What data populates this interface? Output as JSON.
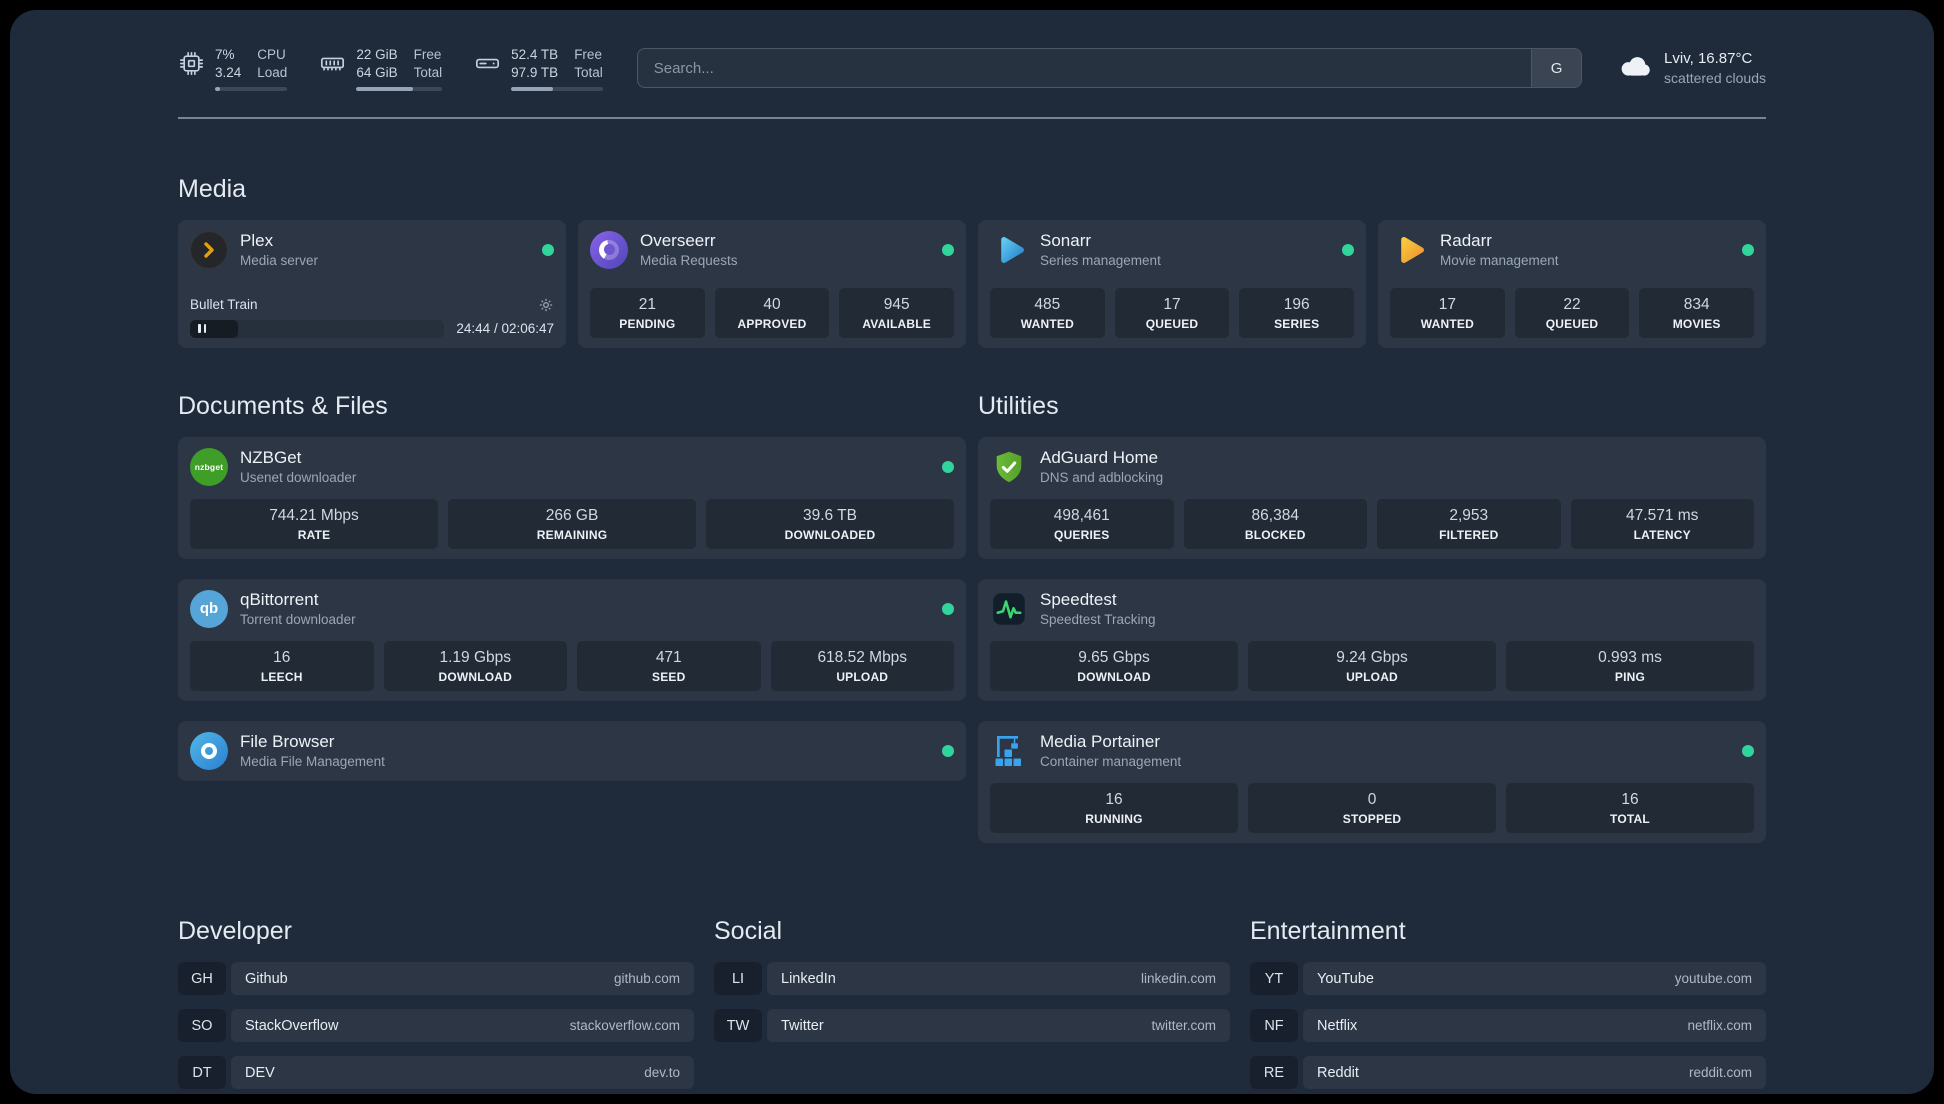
{
  "topbar": {
    "resources": [
      {
        "top_value": "7%",
        "bottom_value": "3.24",
        "top_label": "CPU",
        "bottom_label": "Load",
        "progress": 7
      },
      {
        "top_value": "22 GiB",
        "bottom_value": "64 GiB",
        "top_label": "Free",
        "bottom_label": "Total",
        "progress": 66
      },
      {
        "top_value": "52.4 TB",
        "bottom_value": "97.9 TB",
        "top_label": "Free",
        "bottom_label": "Total",
        "progress": 46
      }
    ],
    "search": {
      "placeholder": "Search...",
      "button_label": "G"
    },
    "weather": {
      "location": "Lviv, 16.87°C",
      "condition": "scattered clouds"
    }
  },
  "sections": {
    "media": {
      "title": "Media",
      "plex": {
        "name": "Plex",
        "desc": "Media server",
        "now_playing": "Bullet Train",
        "time": "24:44 / 02:06:47",
        "progress": 19
      },
      "overseerr": {
        "name": "Overseerr",
        "desc": "Media Requests",
        "stats": [
          {
            "value": "21",
            "label": "PENDING"
          },
          {
            "value": "40",
            "label": "APPROVED"
          },
          {
            "value": "945",
            "label": "AVAILABLE"
          }
        ]
      },
      "sonarr": {
        "name": "Sonarr",
        "desc": "Series management",
        "stats": [
          {
            "value": "485",
            "label": "WANTED"
          },
          {
            "value": "17",
            "label": "QUEUED"
          },
          {
            "value": "196",
            "label": "SERIES"
          }
        ]
      },
      "radarr": {
        "name": "Radarr",
        "desc": "Movie management",
        "stats": [
          {
            "value": "17",
            "label": "WANTED"
          },
          {
            "value": "22",
            "label": "QUEUED"
          },
          {
            "value": "834",
            "label": "MOVIES"
          }
        ]
      }
    },
    "documents": {
      "title": "Documents & Files",
      "nzbget": {
        "name": "NZBGet",
        "desc": "Usenet downloader",
        "stats": [
          {
            "value": "744.21 Mbps",
            "label": "RATE"
          },
          {
            "value": "266 GB",
            "label": "REMAINING"
          },
          {
            "value": "39.6 TB",
            "label": "DOWNLOADED"
          }
        ]
      },
      "qbittorrent": {
        "name": "qBittorrent",
        "desc": "Torrent downloader",
        "stats": [
          {
            "value": "16",
            "label": "LEECH"
          },
          {
            "value": "1.19 Gbps",
            "label": "DOWNLOAD"
          },
          {
            "value": "471",
            "label": "SEED"
          },
          {
            "value": "618.52 Mbps",
            "label": "UPLOAD"
          }
        ]
      },
      "filebrowser": {
        "name": "File Browser",
        "desc": "Media File Management"
      }
    },
    "utilities": {
      "title": "Utilities",
      "adguard": {
        "name": "AdGuard Home",
        "desc": "DNS and adblocking",
        "stats": [
          {
            "value": "498,461",
            "label": "QUERIES"
          },
          {
            "value": "86,384",
            "label": "BLOCKED"
          },
          {
            "value": "2,953",
            "label": "FILTERED"
          },
          {
            "value": "47.571 ms",
            "label": "LATENCY"
          }
        ]
      },
      "speedtest": {
        "name": "Speedtest",
        "desc": "Speedtest Tracking",
        "stats": [
          {
            "value": "9.65 Gbps",
            "label": "DOWNLOAD"
          },
          {
            "value": "9.24 Gbps",
            "label": "UPLOAD"
          },
          {
            "value": "0.993 ms",
            "label": "PING"
          }
        ]
      },
      "portainer": {
        "name": "Media Portainer",
        "desc": "Container management",
        "stats": [
          {
            "value": "16",
            "label": "RUNNING"
          },
          {
            "value": "0",
            "label": "STOPPED"
          },
          {
            "value": "16",
            "label": "TOTAL"
          }
        ]
      }
    },
    "bookmarks": {
      "developer": {
        "title": "Developer",
        "links": [
          {
            "abbr": "GH",
            "name": "Github",
            "url": "github.com"
          },
          {
            "abbr": "SO",
            "name": "StackOverflow",
            "url": "stackoverflow.com"
          },
          {
            "abbr": "DT",
            "name": "DEV",
            "url": "dev.to"
          }
        ]
      },
      "social": {
        "title": "Social",
        "links": [
          {
            "abbr": "LI",
            "name": "LinkedIn",
            "url": "linkedin.com"
          },
          {
            "abbr": "TW",
            "name": "Twitter",
            "url": "twitter.com"
          }
        ]
      },
      "entertainment": {
        "title": "Entertainment",
        "links": [
          {
            "abbr": "YT",
            "name": "YouTube",
            "url": "youtube.com"
          },
          {
            "abbr": "NF",
            "name": "Netflix",
            "url": "netflix.com"
          },
          {
            "abbr": "RE",
            "name": "Reddit",
            "url": "reddit.com"
          }
        ]
      }
    }
  },
  "icons": {
    "nzbget_text": "nzbget",
    "qbittorrent_text": "qb"
  }
}
